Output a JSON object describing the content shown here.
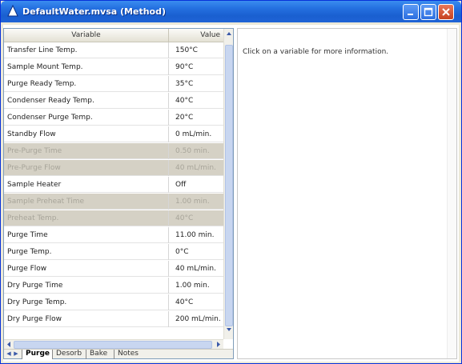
{
  "window": {
    "title": "DefaultWater.mvsa (Method)",
    "title_bar_color": "#2470e0"
  },
  "grid": {
    "header": {
      "variable": "Variable",
      "value": "Value"
    },
    "rows": [
      {
        "variable": "Transfer Line Temp.",
        "value": "150°C",
        "disabled": false
      },
      {
        "variable": "Sample Mount Temp.",
        "value": "90°C",
        "disabled": false
      },
      {
        "variable": "Purge Ready Temp.",
        "value": "35°C",
        "disabled": false
      },
      {
        "variable": "Condenser Ready Temp.",
        "value": "40°C",
        "disabled": false
      },
      {
        "variable": "Condenser Purge Temp.",
        "value": "20°C",
        "disabled": false
      },
      {
        "variable": "Standby Flow",
        "value": "0 mL/min.",
        "disabled": false
      },
      {
        "variable": "Pre-Purge Time",
        "value": "0.50 min.",
        "disabled": true
      },
      {
        "variable": "Pre-Purge Flow",
        "value": "40 mL/min.",
        "disabled": true
      },
      {
        "variable": "Sample Heater",
        "value": "Off",
        "disabled": false
      },
      {
        "variable": "Sample Preheat Time",
        "value": "1.00 min.",
        "disabled": true
      },
      {
        "variable": "Preheat Temp.",
        "value": "40°C",
        "disabled": true
      },
      {
        "variable": "Purge Time",
        "value": "11.00 min.",
        "disabled": false
      },
      {
        "variable": "Purge Temp.",
        "value": "0°C",
        "disabled": false
      },
      {
        "variable": "Purge Flow",
        "value": "40 mL/min.",
        "disabled": false
      },
      {
        "variable": "Dry Purge Time",
        "value": "1.00 min.",
        "disabled": false
      },
      {
        "variable": "Dry Purge Temp.",
        "value": "40°C",
        "disabled": false
      },
      {
        "variable": "Dry Purge Flow",
        "value": "200 mL/min.",
        "disabled": false
      }
    ]
  },
  "tabs": [
    {
      "label": "Purge",
      "active": true
    },
    {
      "label": "Desorb",
      "active": false
    },
    {
      "label": "Bake",
      "active": false
    },
    {
      "label": "Notes",
      "active": false
    }
  ],
  "info_panel": {
    "text": "Click on a variable for more information."
  },
  "icons": {
    "title": "app-icon",
    "minimize": "minimize-icon",
    "maximize": "maximize-icon",
    "close": "close-icon"
  }
}
